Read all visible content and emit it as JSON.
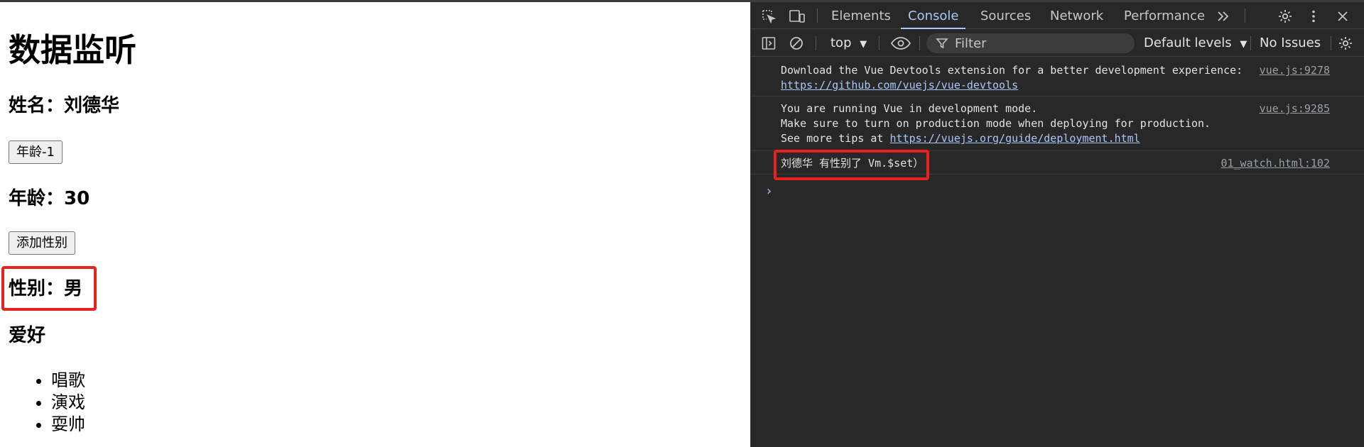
{
  "page": {
    "title": "数据监听",
    "name_line": "姓名：刘德华",
    "age_button": "年龄-1",
    "age_line": "年龄：30",
    "gender_button": "添加性别",
    "gender_line": "性别：男",
    "hobby_title": "爱好",
    "hobbies": [
      "唱歌",
      "演戏",
      "耍帅"
    ]
  },
  "devtools": {
    "tabs": [
      "Elements",
      "Console",
      "Sources",
      "Network",
      "Performance"
    ],
    "active_tab": "Console",
    "toolbar": {
      "context": "top",
      "filter_placeholder": "Filter",
      "levels": "Default levels",
      "issues": "No Issues"
    },
    "messages": [
      {
        "lines": [
          "Download the Vue Devtools extension for a better development experience:"
        ],
        "link": "https://github.com/vuejs/vue-devtools",
        "source": "vue.js:9278"
      },
      {
        "lines": [
          "You are running Vue in development mode.",
          "Make sure to turn on production mode when deploying for production."
        ],
        "prefix": "See more tips at ",
        "link": "https://vuejs.org/guide/deployment.html",
        "source": "vue.js:9285"
      },
      {
        "lines": [
          "刘德华 有性别了 Vm.$set）"
        ],
        "source": "01_watch.html:102"
      }
    ],
    "prompt": "›"
  },
  "colors": {
    "highlight": "#e8231d",
    "devtools_bg": "#282828",
    "accent": "#a8c7fa"
  }
}
